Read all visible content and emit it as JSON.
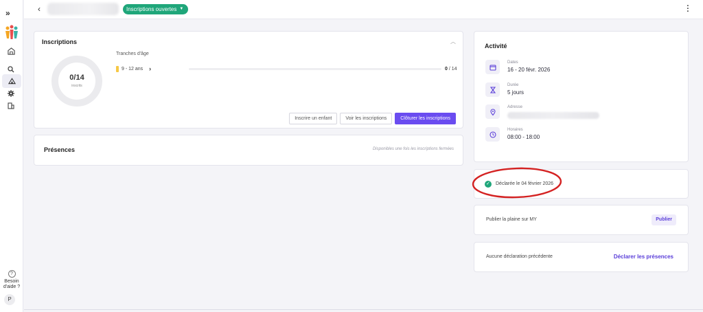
{
  "topbar": {
    "status_label": "Inscriptions ouvertes"
  },
  "sidebar": {
    "help_line1": "Besoin",
    "help_line2": "d'aide ?",
    "avatar_initial": "P"
  },
  "inscriptions": {
    "title": "Inscriptions",
    "ring_count": "0/14",
    "ring_label": "inscrits",
    "tranches_label": "Tranches d'âge",
    "band_label": "9 - 12 ans",
    "band_fill": 0,
    "ratio_current": "0",
    "ratio_total": "/ 14",
    "buttons": {
      "enroll": "Inscrire un enfant",
      "view": "Voir les inscriptions",
      "close": "Clôturer les inscriptions"
    },
    "colors": {
      "accent": "#6a4cf0",
      "band": "#f6c845"
    }
  },
  "presences": {
    "title": "Présences",
    "note": "Disponibles une fois les inscriptions fermées"
  },
  "activite": {
    "title": "Activité",
    "dates_label": "Dates",
    "dates_value": "16 - 20 févr. 2026",
    "duree_label": "Durée",
    "duree_value": "5 jours",
    "adresse_label": "Adresse",
    "horaires_label": "Horaires",
    "horaires_value": "08:00 - 18:00"
  },
  "declaration": {
    "text": "Déclarée le 04 février 2026",
    "status_color": "#1fa67a"
  },
  "publier": {
    "text": "Publier la plaine sur MY",
    "button": "Publier"
  },
  "previous": {
    "text": "Aucune déclaration précédente",
    "link": "Déclarer les présences"
  }
}
